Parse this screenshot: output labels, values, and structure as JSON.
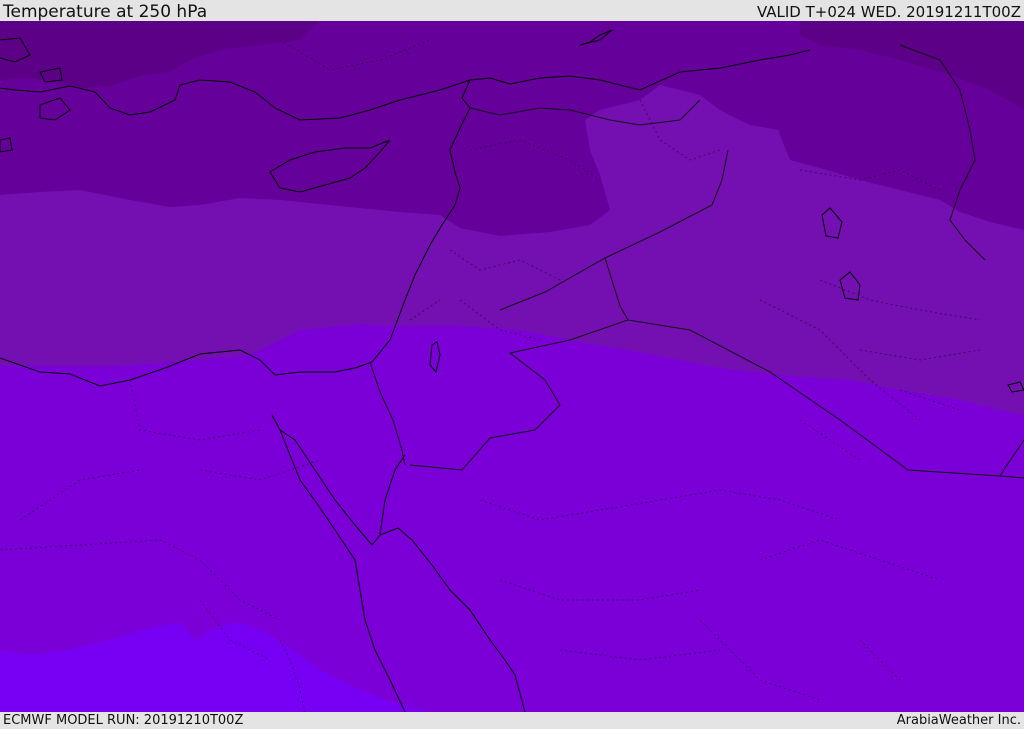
{
  "header": {
    "title": "Temperature at 250 hPa",
    "valid": "VALID T+024 WED. 20191211T00Z"
  },
  "footer": {
    "model_run": "ECMWF MODEL RUN: 20191210T00Z",
    "credit": "ArabiaWeather Inc."
  },
  "map": {
    "field": "Temperature at 250 hPa",
    "colors": {
      "darkest": "#5c0088",
      "darker": "#66009a",
      "mid": "#7410b2",
      "light": "#7b00d8",
      "lightest": "#7700f4"
    }
  }
}
